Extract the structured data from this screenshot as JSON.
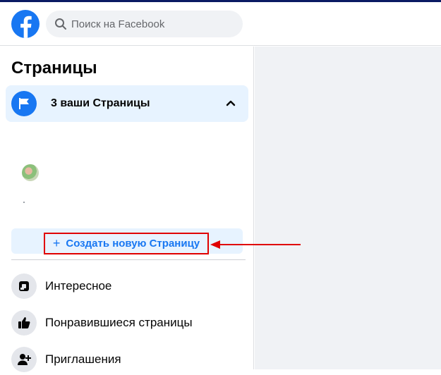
{
  "header": {
    "logo": "facebook-logo-icon",
    "search_placeholder": "Поиск на Facebook"
  },
  "sidebar": {
    "title": "Страницы",
    "your_pages": {
      "label": "3 ваши Страницы",
      "expanded": true
    },
    "create_page_label": "Создать новую Страницу",
    "items": [
      {
        "label": "Интересное",
        "icon": "discover-icon"
      },
      {
        "label": "Понравившиеся страницы",
        "icon": "thumbs-up-icon"
      },
      {
        "label": "Приглашения",
        "icon": "invite-user-icon"
      }
    ]
  },
  "colors": {
    "brand": "#1877f2",
    "highlight": "#e00000",
    "main_bg": "#f0f2f5",
    "selected_bg": "#e7f3ff"
  }
}
